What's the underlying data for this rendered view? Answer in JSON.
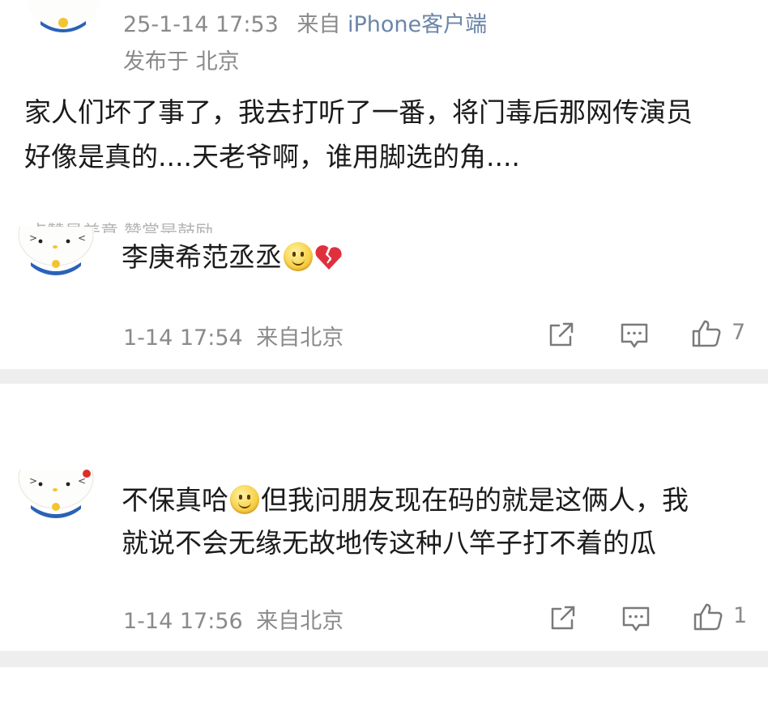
{
  "post": {
    "timestamp": "25-1-14 17:53",
    "via_prefix": "来自",
    "client": "iPhone客户端",
    "location": "发布于 北京",
    "text_line1": "家人们坏了事了，我去打听了一番，将门毒后那网传演员",
    "text_line2": "好像是真的....天老爷啊，谁用脚选的角...."
  },
  "comment1": {
    "hint_text": "点赞是美意  赞赏是鼓励",
    "text": "李庚希范丞丞",
    "emoji_icons": [
      "smile-emoji-icon",
      "broken-heart-icon"
    ],
    "timestamp": "1-14 17:54",
    "source": "来自北京",
    "like_count": "7"
  },
  "comment2": {
    "text_line1_a": "不保真哈",
    "text_line1_b": "但我问朋友现在码的就是这俩人，我",
    "text_line2": "就说不会无缘无故地传这种八竿子打不着的瓜",
    "emoji_icons": [
      "smile-emoji-icon"
    ],
    "timestamp": "1-14 17:56",
    "source": "来自北京",
    "like_count": "1"
  },
  "icons": [
    "avatar-hello-kitty-icon",
    "share-icon",
    "comment-icon",
    "like-thumb-icon"
  ],
  "colors": {
    "meta_gray": "#8a8a8a",
    "client_blue": "#6b86a8",
    "divider": "#eeeeee"
  }
}
